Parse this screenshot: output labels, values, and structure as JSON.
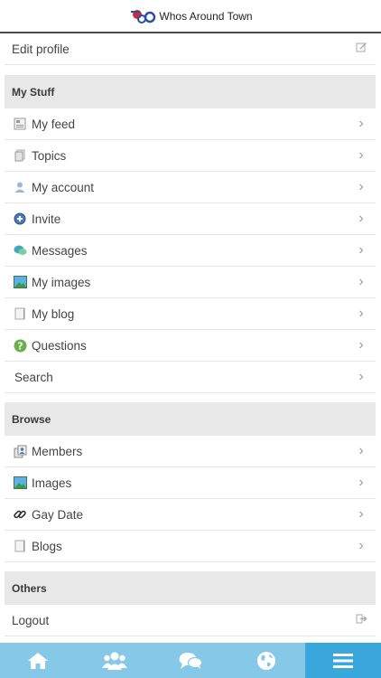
{
  "header": {
    "app_title": "Whos Around Town"
  },
  "top": {
    "edit_profile": "Edit profile"
  },
  "sections": {
    "my_stuff": "My Stuff",
    "browse": "Browse",
    "others": "Others"
  },
  "my_stuff_items": [
    {
      "label": "My feed",
      "icon": "feed-icon"
    },
    {
      "label": "Topics",
      "icon": "topics-icon"
    },
    {
      "label": "My account",
      "icon": "user-icon"
    },
    {
      "label": "Invite",
      "icon": "invite-icon"
    },
    {
      "label": "Messages",
      "icon": "messages-icon"
    },
    {
      "label": "My images",
      "icon": "images-icon"
    },
    {
      "label": "My blog",
      "icon": "blog-icon"
    },
    {
      "label": "Questions",
      "icon": "question-icon"
    },
    {
      "label": "Search",
      "icon": ""
    }
  ],
  "browse_items": [
    {
      "label": "Members",
      "icon": "members-icon"
    },
    {
      "label": "Images",
      "icon": "images-icon"
    },
    {
      "label": "Gay Date",
      "icon": "link-icon"
    },
    {
      "label": "Blogs",
      "icon": "blog-icon"
    }
  ],
  "others_items": [
    {
      "label": "Logout",
      "icon": "logout-icon"
    }
  ],
  "tabbar": {
    "tabs": [
      "home-icon",
      "people-icon",
      "chat-icon",
      "globe-icon",
      "menu-icon"
    ],
    "active_tab": "menu-icon"
  },
  "colors": {
    "tabbar_bg": "#86c8e8",
    "tab_active": "#3aa8dc",
    "section_bg": "#e8e8e8"
  }
}
